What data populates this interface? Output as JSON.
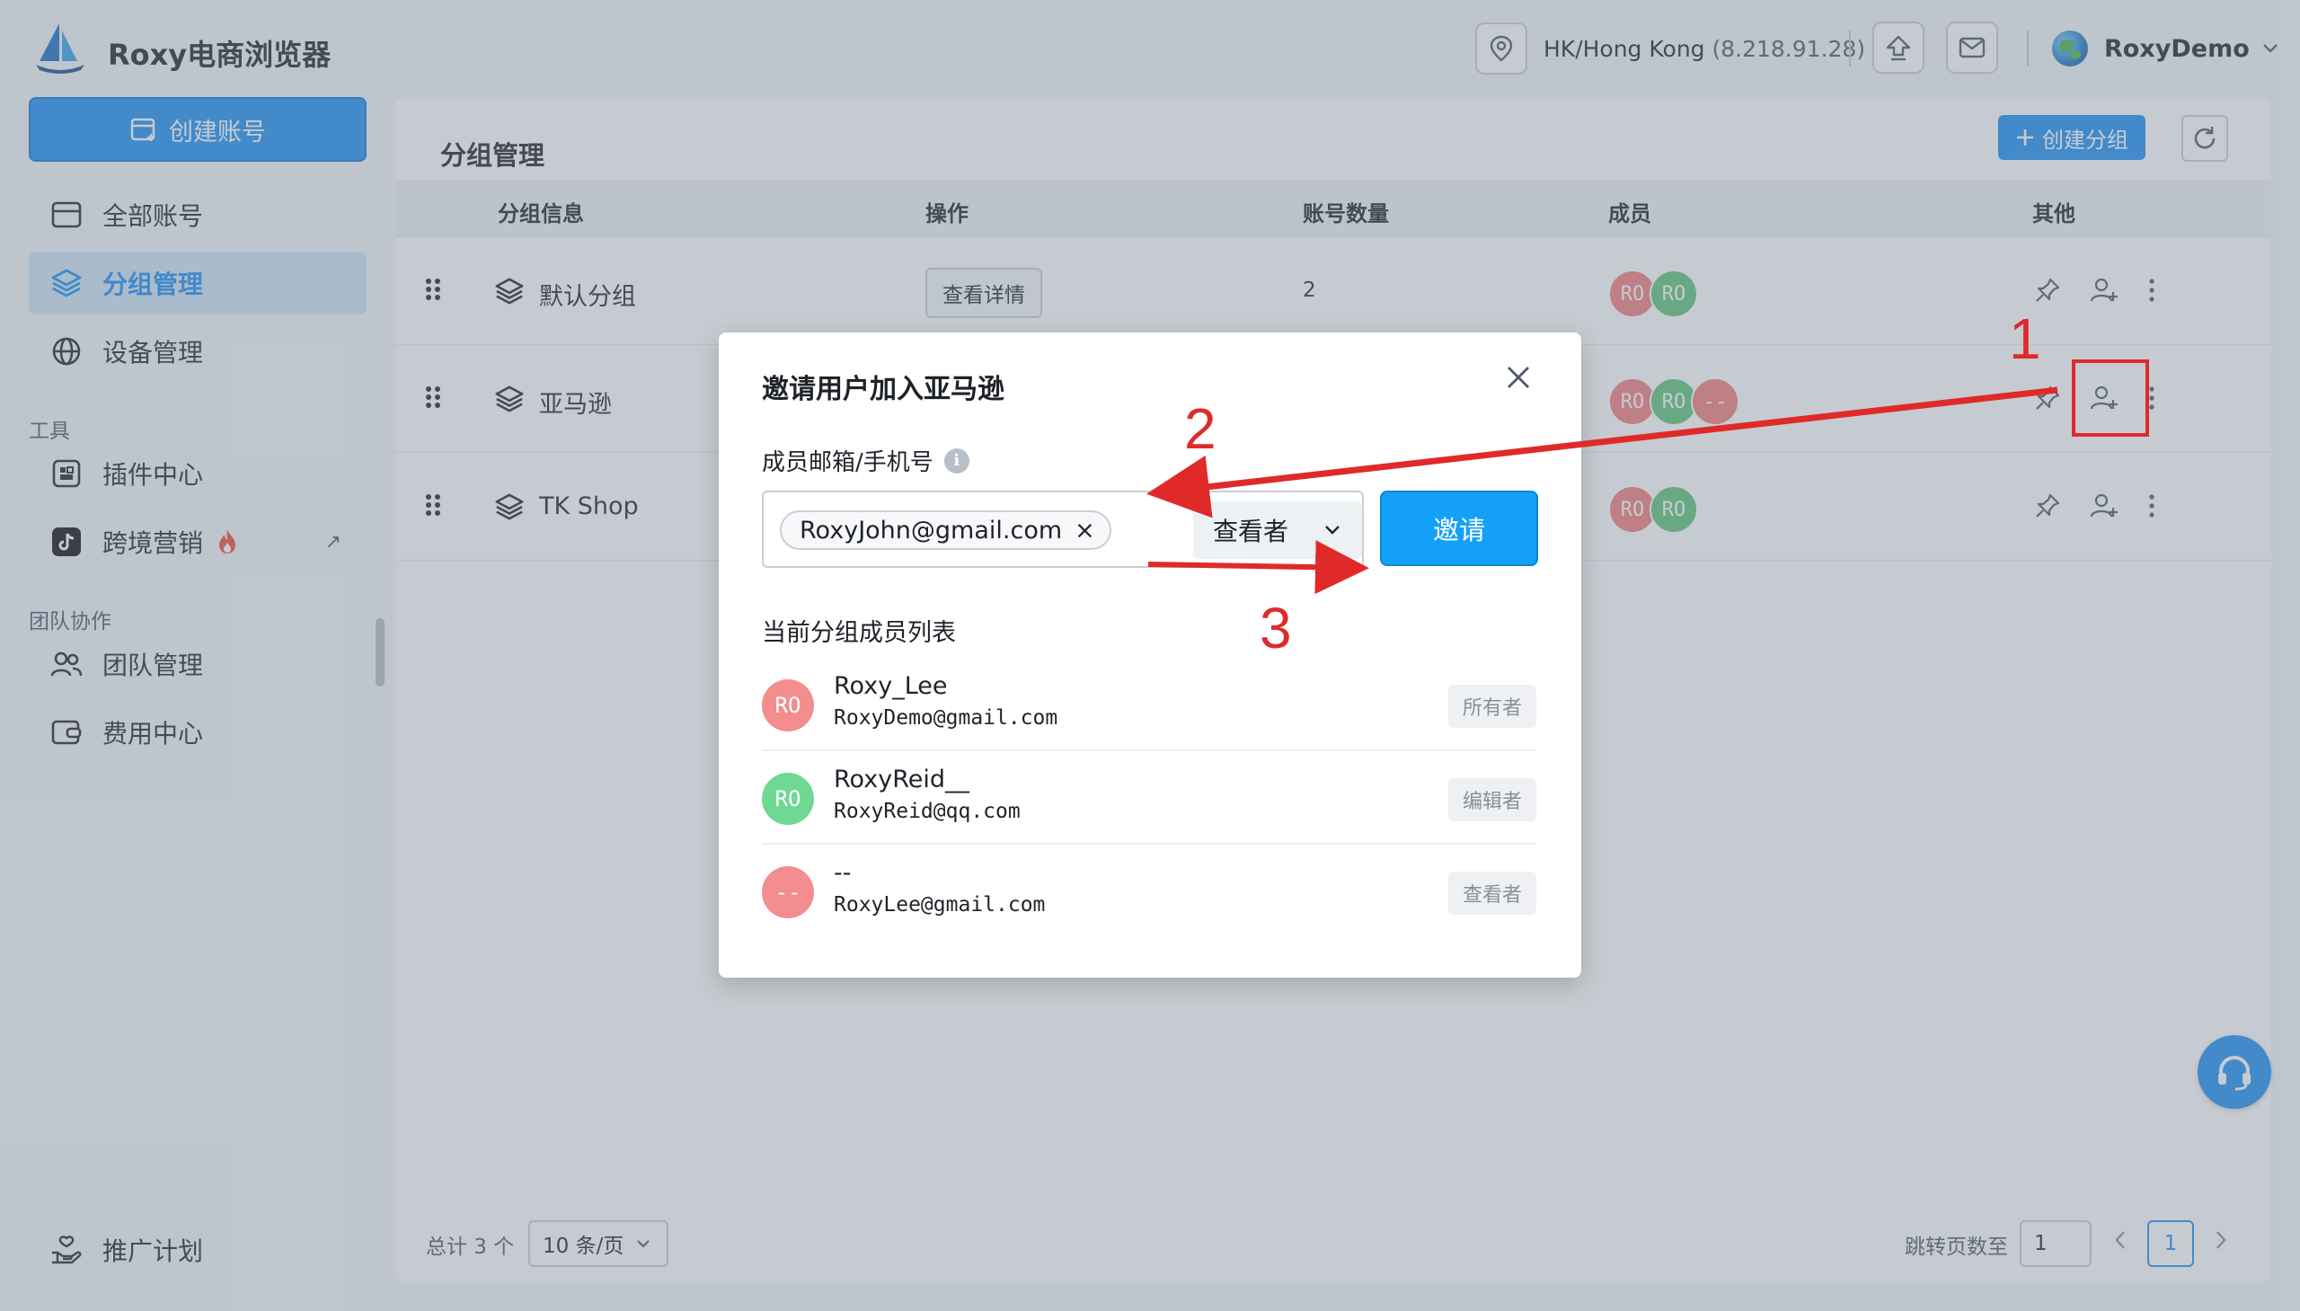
{
  "app": {
    "brand": "Roxy电商浏览器",
    "location": "HK/Hong Kong",
    "ip": "(8.218.91.28)",
    "user": "RoxyDemo"
  },
  "sidebar": {
    "create_account": "创建账号",
    "items": [
      {
        "label": "全部账号",
        "icon": "window-icon"
      },
      {
        "label": "分组管理",
        "icon": "layers-icon",
        "active": true
      },
      {
        "label": "设备管理",
        "icon": "globe-icon"
      }
    ],
    "tools_title": "工具",
    "tools": [
      {
        "label": "插件中心",
        "icon": "plugin-icon"
      },
      {
        "label": "跨境营销",
        "icon": "tiktok-icon",
        "badge": "fire-icon",
        "external": "↗"
      }
    ],
    "team_title": "团队协作",
    "team": [
      {
        "label": "团队管理",
        "icon": "users-icon"
      },
      {
        "label": "费用中心",
        "icon": "wallet-icon"
      }
    ],
    "promo": "推广计划"
  },
  "main": {
    "title": "分组管理",
    "create_group": "创建分组",
    "columns": [
      "分组信息",
      "操作",
      "账号数量",
      "成员",
      "其他"
    ],
    "rows": [
      {
        "name": "默认分组",
        "action": "查看详情",
        "count": "2",
        "members": [
          {
            "t": "RO",
            "c": "red"
          },
          {
            "t": "RO",
            "c": "green"
          }
        ]
      },
      {
        "name": "亚马逊",
        "members": [
          {
            "t": "RO",
            "c": "red"
          },
          {
            "t": "RO",
            "c": "green"
          },
          {
            "t": "--",
            "c": "red"
          }
        ]
      },
      {
        "name": "TK Shop",
        "members": [
          {
            "t": "RO",
            "c": "red"
          },
          {
            "t": "RO",
            "c": "green"
          }
        ]
      }
    ],
    "footer": {
      "total": "总计 3 个",
      "page_size": "10 条/页",
      "jump_label": "跳转页数至",
      "jump_value": "1",
      "current_page": "1"
    }
  },
  "modal": {
    "title": "邀请用户加入亚马逊",
    "field_label": "成员邮箱/手机号",
    "info_glyph": "i",
    "tag_value": "RoxyJohn@gmail.com",
    "tag_remove": "×",
    "role": "查看者",
    "invite": "邀请",
    "list_title": "当前分组成员列表",
    "members": [
      {
        "avatar": "RO",
        "color": "red",
        "name": "Roxy_Lee",
        "email": "RoxyDemo@gmail.com",
        "role": "所有者"
      },
      {
        "avatar": "RO",
        "color": "green",
        "name": "RoxyReid__",
        "email": "RoxyReid@qq.com",
        "role": "编辑者"
      },
      {
        "avatar": "--",
        "color": "red",
        "name": "--",
        "email": "RoxyLee@gmail.com",
        "role": "查看者"
      }
    ]
  },
  "annotations": {
    "step1": "1",
    "step2": "2",
    "step3": "3",
    "color": "#e02a2a"
  },
  "colors": {
    "primary": "#1d8ff2",
    "invite": "#15a0f8",
    "avatar_red": "#f27d7d",
    "avatar_green": "#5dc479"
  }
}
